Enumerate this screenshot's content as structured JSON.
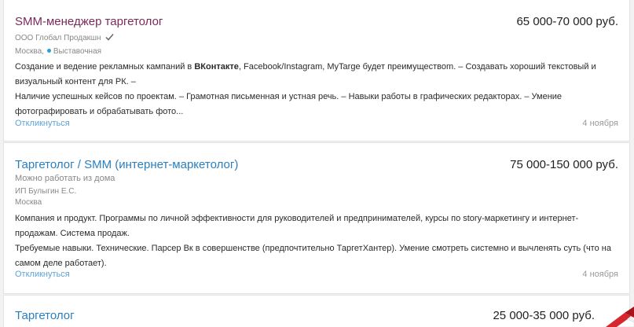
{
  "vacancies": [
    {
      "title": "SMM-менеджер таргетолог",
      "salary": "65 000-70 000 руб.",
      "company": "ООО Глобал Продакшн",
      "city": "Москва,",
      "metro": "Выставочная",
      "desc_p1_a": "Создание и ведение рекламных кампаний в ",
      "desc_p1_b": "ВКонтакте",
      "desc_p1_c": ", Facebook/Instagram, MyTarge будет преимуществоm. – Создавать хороший текстовый и визуальный контент для РК. –",
      "desc_p2": "Наличие успешных кейсов по проектам. – Грамотная письменная и устная речь. – Навыки работы в графических редакторах. – Умение фотографировать и обрабатывать фото...",
      "respond_label": "Откликнуться",
      "date": "4 ноября"
    },
    {
      "title": "Таргетолог / SMM (интернет-маркетолог)",
      "salary": "75 000-150 000 руб.",
      "remote": "Можно работать из дома",
      "company": "ИП Булыгин Е.С.",
      "city": "Москва",
      "desc_p1": "Компания и продукт. Программы по личной эффективности для руководителей и предпринимателей, курсы по story-маркетингу и интернет-продажам. Система продаж.",
      "desc_p2": "Требуемые навыки. Технические. Парсер Вк в совершенстве (предпочтительно ТаргетХантер). Умение смотреть системно и вычленять суть (что на самом деле работает).",
      "respond_label": "Откликнуться",
      "date": "4 ноября"
    },
    {
      "title": "Таргетолог",
      "salary": "25 000-35 000 руб."
    }
  ],
  "colors": {
    "visited_title": "#7b2a5c",
    "title_link": "#2a7fbf",
    "respond_link": "#5da2d6",
    "metro_dot": "#2a9fd8"
  },
  "icons": [
    "verified-check-icon",
    "metro-dot-icon",
    "corner-decoration"
  ]
}
